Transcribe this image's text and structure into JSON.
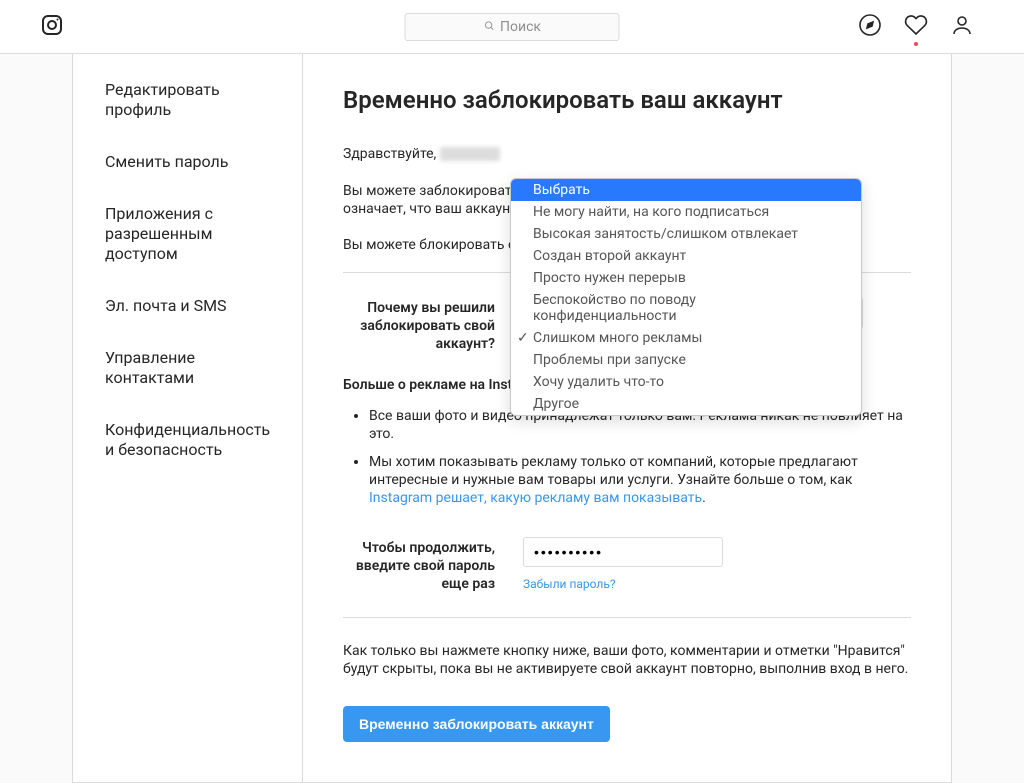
{
  "header": {
    "search_placeholder": "Поиск"
  },
  "sidebar": {
    "items": [
      "Редактировать профиль",
      "Сменить пароль",
      "Приложения с разрешенным доступом",
      "Эл. почта и SMS",
      "Управление контактами",
      "Конфиденциальность и безопасность"
    ]
  },
  "main": {
    "title": "Временно заблокировать ваш аккаунт",
    "greeting": "Здравствуйте, ",
    "para1": "Вы можете заблокировать свой аккаунт вместо того, чтобы удалять его. Это означает, что ваш аккаунт будет скрыт, по",
    "para2": "Вы можете блокировать свой а",
    "form": {
      "reason_label": "Почему вы решили заблокировать свой аккаунт?",
      "more_about": "Больше о рекламе на Instagram:",
      "bullet1": "Все ваши фото и видео принадлежат только вам. Реклама никак не повлияет на это.",
      "bullet2_a": "Мы хотим показывать рекламу только от компаний, которые предлагают интересные и нужные вам товары или услуги. Узнайте больше о том, как ",
      "bullet2_link": "Instagram решает, какую рекламу вам показывать",
      "bullet2_b": ".",
      "password_label": "Чтобы продолжить, введите свой пароль еще раз",
      "password_value": "••••••••••",
      "forgot": "Забыли пароль?"
    },
    "final": "Как только вы нажмете кнопку ниже, ваши фото, комментарии и отметки \"Нравится\" будут скрыты, пока вы не активируете свой аккаунт повторно, выполнив вход в него.",
    "submit": "Временно заблокировать аккаунт"
  },
  "dropdown": {
    "options": [
      "Выбрать",
      "Не могу найти, на кого подписаться",
      "Высокая занятость/слишком отвлекает",
      "Создан второй аккаунт",
      "Просто нужен перерыв",
      "Беспокойство по поводу конфиденциальности",
      "Слишком много рекламы",
      "Проблемы при запуске",
      "Хочу удалить что-то",
      "Другое"
    ],
    "highlighted_index": 0,
    "checked_index": 6
  }
}
